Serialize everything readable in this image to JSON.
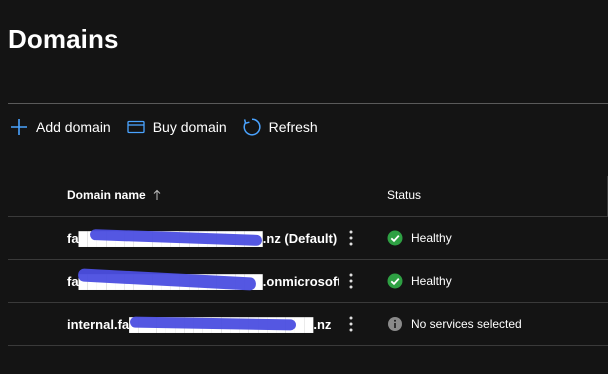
{
  "page": {
    "title": "Domains"
  },
  "toolbar": {
    "add_label": "Add domain",
    "add_icon": "plus-icon",
    "buy_label": "Buy domain",
    "buy_icon": "card-icon",
    "refresh_label": "Refresh",
    "refresh_icon": "refresh-icon"
  },
  "grid": {
    "columns": {
      "domain": "Domain name",
      "status": "Status"
    },
    "sort_icon": "arrow-up-icon",
    "rows": [
      {
        "name": "fa████████████████████.nz (Default)",
        "status": "Healthy",
        "status_icon": "check-circle-icon",
        "status_color": "#2ea043"
      },
      {
        "name": "fa████████████████████.onmicrosoft....",
        "status": "Healthy",
        "status_icon": "check-circle-icon",
        "status_color": "#2ea043"
      },
      {
        "name": "internal.fa████████████████████.nz",
        "status": "No services selected",
        "status_icon": "info-circle-icon",
        "status_color": "#8a8a8a"
      }
    ]
  },
  "colors": {
    "background": "#141414",
    "redaction": "#4b4ee0",
    "accent": "#4aa3ff"
  }
}
